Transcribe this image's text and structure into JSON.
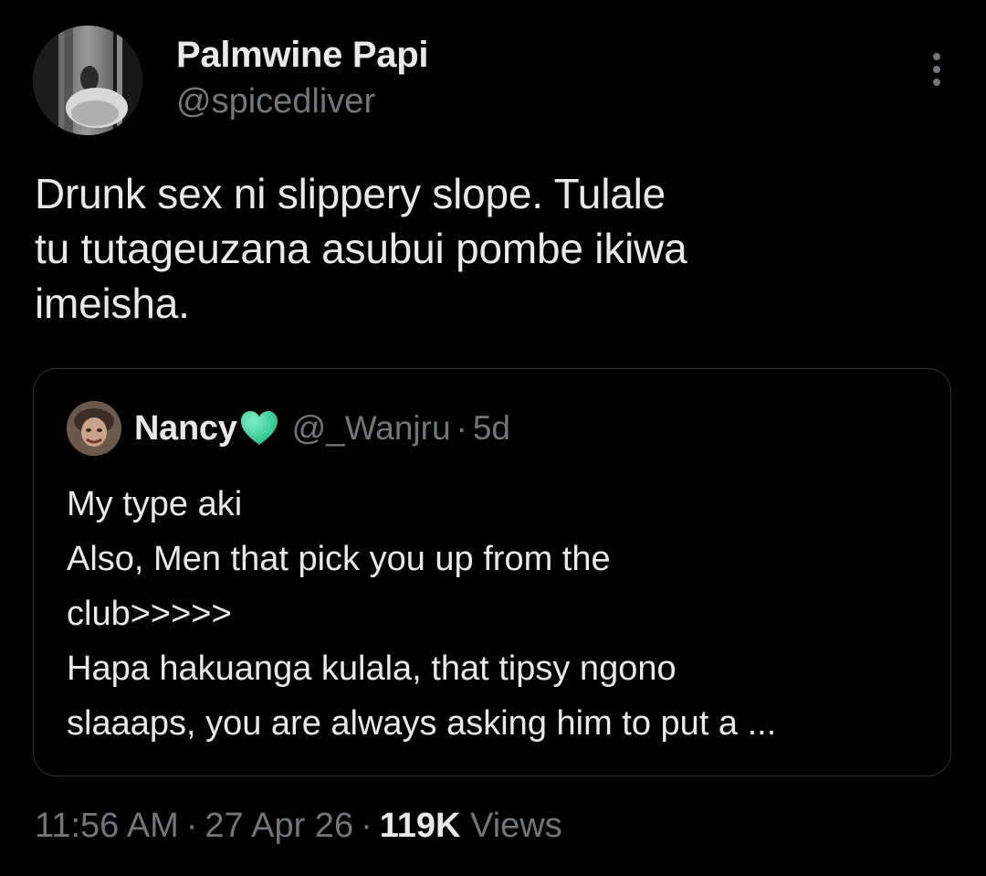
{
  "author": {
    "display_name": "Palmwine Papi",
    "handle": "@spicedliver",
    "avatar": "avatar-photo-grayscale"
  },
  "more_icon": "more-vertical-icon",
  "tweet": {
    "text": "Drunk sex ni slippery slope. Tulale\ntu tutageuzana asubui pombe ikiwa\nimeisha."
  },
  "quoted": {
    "display_name": "Nancy",
    "emoji_icon": "green-heart-icon",
    "handle": "@_Wanjru",
    "dot": "·",
    "time": "5d",
    "text": "My type aki\nAlso, Men that pick you up from the\nclub>>>>>\nHapa hakuanga kulala, that tipsy ngono\nslaaaps, you are always asking him to put a ..."
  },
  "meta": {
    "time": "11:56 AM",
    "sep1": "·",
    "date": "27 Apr 26",
    "sep2": "·",
    "views_count": "119K",
    "views_label": "Views"
  },
  "colors": {
    "background": "#000000",
    "primary_text": "#e7e9ea",
    "secondary_text": "#71767b",
    "border": "#2f3336",
    "heart": "#2ed39a"
  }
}
